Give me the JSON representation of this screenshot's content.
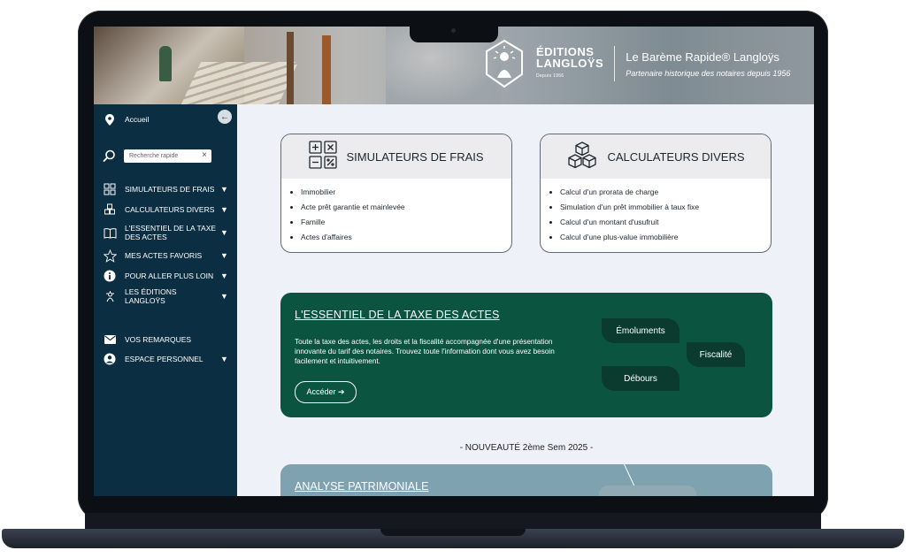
{
  "header": {
    "brand_line1": "ÉDITIONS",
    "brand_line2": "LANGLOŸS",
    "brand_since": "Depuis 1956",
    "product_title": "Le Barème Rapide® Langloÿs",
    "tagline": "Partenaire historique des notaires depuis 1956"
  },
  "sidebar": {
    "home_label": "Accueil",
    "search_placeholder": "Recherche rapide",
    "items": [
      {
        "label": "SIMULATEURS DE FRAIS",
        "icon": "grid-icon"
      },
      {
        "label": "CALCULATEURS DIVERS",
        "icon": "cubes-icon"
      },
      {
        "label": "L'ESSENTIEL DE LA TAXE DES ACTES",
        "icon": "book-icon"
      },
      {
        "label": "MES ACTES FAVORIS",
        "icon": "star-icon"
      },
      {
        "label": "POUR ALLER PLUS LOIN",
        "icon": "info-icon"
      },
      {
        "label": "LES ÉDITIONS LANGLOŸS",
        "icon": "logo-icon"
      }
    ],
    "remarks_label": "VOS REMARQUES",
    "account_label": "ESPACE PERSONNEL"
  },
  "cards": {
    "sim": {
      "title": "SIMULATEURS DE FRAIS",
      "items": [
        "Immobilier",
        "Acte prêt garantie et mainlevée",
        "Famille",
        "Actes d'affaires"
      ]
    },
    "calc": {
      "title": "CALCULATEURS DIVERS",
      "items": [
        "Calcul d'un prorata de charge",
        "Simulation d'un prêt immobilier à taux fixe",
        "Calcul d'un montant d'usufruit",
        "Calcul d'une plus-value immobilière"
      ]
    }
  },
  "tax": {
    "title": "L'ESSENTIEL DE LA TAXE DES ACTES",
    "description": "Toute la taxe des actes, les droits et la fiscalité accompagnée d'une présentation innovante du tarif des notaires. Trouvez toute l'information dont vous avez besoin facilement et intuitivement.",
    "button": "Accéder ➔",
    "pills": [
      "Émoluments",
      "Fiscalité",
      "Débours"
    ]
  },
  "nouveaute": "- NOUVEAUTÉ 2ème Sem 2025 -",
  "analyse": {
    "title": "ANALYSE PATRIMONIALE"
  },
  "colors": {
    "sidebar": "#0c2e42",
    "tax_bg": "#0b5440",
    "pill_bg": "#0a3b2e",
    "analyse_bg": "#7ea2b0"
  }
}
